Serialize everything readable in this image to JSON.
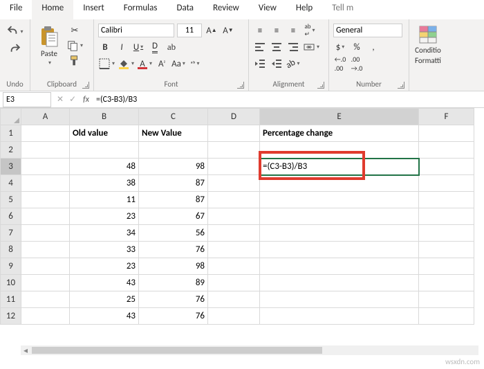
{
  "tabs": {
    "file": "File",
    "home": "Home",
    "insert": "Insert",
    "formulas": "Formulas",
    "data": "Data",
    "review": "Review",
    "view": "View",
    "help": "Help",
    "tellme": "Tell m"
  },
  "groups": {
    "undo": "Undo",
    "clipboard": "Clipboard",
    "font": "Font",
    "alignment": "Alignment",
    "number": "Number"
  },
  "clipboard": {
    "paste": "Paste"
  },
  "font": {
    "name": "Calibri",
    "size": "11",
    "bold": "B",
    "italic": "I",
    "underline": "U"
  },
  "number": {
    "format": "General",
    "currency": "$",
    "percent": "%",
    "comma": ",",
    "incDec": ".0",
    "decDec": ".00"
  },
  "conditional": {
    "line1": "Conditio",
    "line2": "Formatti"
  },
  "namebox": "E3",
  "formula": "=(C3-B3)/B3",
  "headers": {
    "A": "A",
    "B": "B",
    "C": "C",
    "D": "D",
    "E": "E",
    "F": "F"
  },
  "rowLabels": [
    "1",
    "2",
    "3",
    "4",
    "5",
    "6",
    "7",
    "8",
    "9",
    "10",
    "11",
    "12"
  ],
  "cells": {
    "B1": "Old value",
    "C1": "New Value",
    "E1": "Percentage change",
    "E3": "=(C3-B3)/B3"
  },
  "data": {
    "oldValues": [
      48,
      38,
      11,
      23,
      34,
      33,
      23,
      43,
      25,
      43
    ],
    "newValues": [
      98,
      87,
      87,
      67,
      56,
      76,
      98,
      89,
      76,
      76
    ]
  },
  "watermark": "wsxdn.com"
}
